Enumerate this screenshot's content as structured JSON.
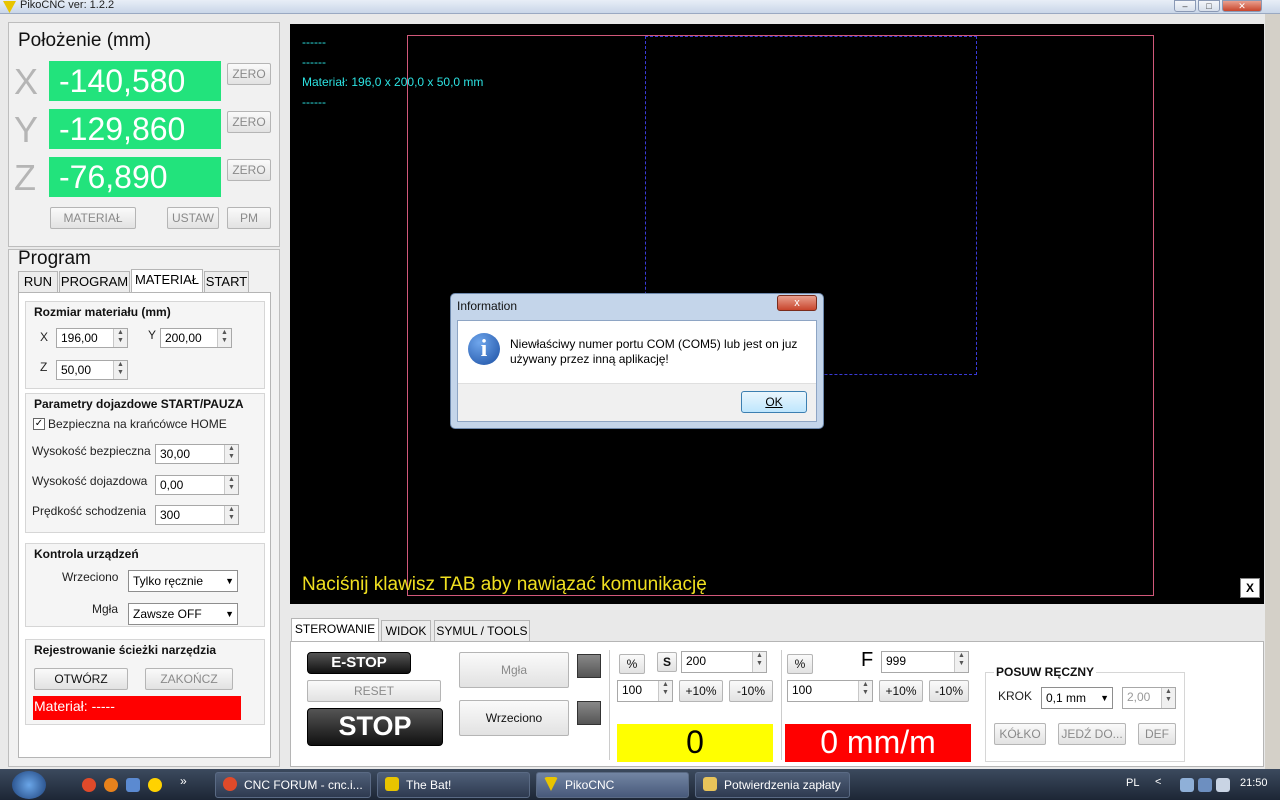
{
  "window": {
    "title": "PikoCNC ver: 1.2.2"
  },
  "position": {
    "heading": "Położenie (mm)",
    "axes": [
      {
        "name": "X",
        "value": "-140,580",
        "zero_label": "ZERO"
      },
      {
        "name": "Y",
        "value": "-129,860",
        "zero_label": "ZERO"
      },
      {
        "name": "Z",
        "value": "-76,890",
        "zero_label": "ZERO"
      }
    ],
    "material_btn": "MATERIAŁ",
    "set_btn": "USTAW",
    "pm_btn": "PM"
  },
  "program": {
    "heading": "Program",
    "tabs": [
      "RUN",
      "PROGRAM",
      "MATERIAŁ",
      "START"
    ],
    "active_tab": "MATERIAŁ",
    "material_size": {
      "title": "Rozmiar materiału (mm)",
      "x_label": "X",
      "x_value": "196,00",
      "y_label": "Y",
      "y_value": "200,00",
      "z_label": "Z",
      "z_value": "50,00"
    },
    "approach": {
      "title": "Parametry dojazdowe START/PAUZA",
      "home_checkbox": "Bezpieczna na krańcówce HOME",
      "home_checked": true,
      "safe_height_label": "Wysokość bezpieczna",
      "safe_height": "30,00",
      "approach_height_label": "Wysokość dojazdowa",
      "approach_height": "0,00",
      "descent_speed_label": "Prędkość schodzenia",
      "descent_speed": "300"
    },
    "devices": {
      "title": "Kontrola urządzeń",
      "spindle_label": "Wrzeciono",
      "spindle_value": "Tylko ręcznie",
      "mist_label": "Mgła",
      "mist_value": "Zawsze OFF"
    },
    "toolpath": {
      "title": "Rejestrowanie ścieżki narzędzia",
      "open_btn": "OTWÓRZ",
      "finish_btn": "ZAKOŃCZ",
      "status": "Materiał: -----"
    }
  },
  "canvas": {
    "lines": [
      "------",
      "------",
      "Materiał: 196,0 x 200,0 x 50,0 mm",
      "------"
    ],
    "message": "Naciśnij klawisz TAB aby nawiązać komunikację",
    "close_label": "X"
  },
  "bottom": {
    "tabs": [
      "STEROWANIE",
      "WIDOK",
      "SYMUL / TOOLS"
    ],
    "estop": "E-STOP",
    "reset": "RESET",
    "stop": "STOP",
    "mist_btn": "Mgła",
    "spindle_btn": "Wrzeciono",
    "spindle": {
      "pct": "%",
      "s_label": "S",
      "s_value": "200",
      "pct_value": "100",
      "plus": "+10%",
      "minus": "-10%",
      "display": "0"
    },
    "feed": {
      "pct": "%",
      "f_label": "F",
      "f_value": "999",
      "pct_value": "100",
      "plus": "+10%",
      "minus": "-10%",
      "display": "0 mm/m"
    },
    "jog": {
      "title": "POSUW RĘCZNY",
      "step_label": "KROK",
      "step_value": "0,1 mm",
      "step_custom": "2,00",
      "circle_btn": "KÓŁKO",
      "goto_btn": "JEDŹ DO...",
      "def_btn": "DEF"
    }
  },
  "dialog": {
    "title": "Information",
    "message": "Niewłaściwy numer portu COM (COM5) lub jest on juz używany przez inną aplikację!",
    "ok": "OK",
    "close": "x"
  },
  "taskbar": {
    "items": [
      "CNC FORUM - cnc.i...",
      "The Bat!",
      "PikoCNC",
      "Potwierdzenia zapłaty"
    ],
    "active": "PikoCNC",
    "lang": "PL",
    "clock": "21:50"
  },
  "colors": {
    "dro_green": "#22e37c",
    "spindle_yellow": "#ffff00",
    "feed_red": "#ff0000",
    "status_red": "#ff0000",
    "canvas_cyan": "#2ce2e2",
    "canvas_message": "#f0e020"
  }
}
